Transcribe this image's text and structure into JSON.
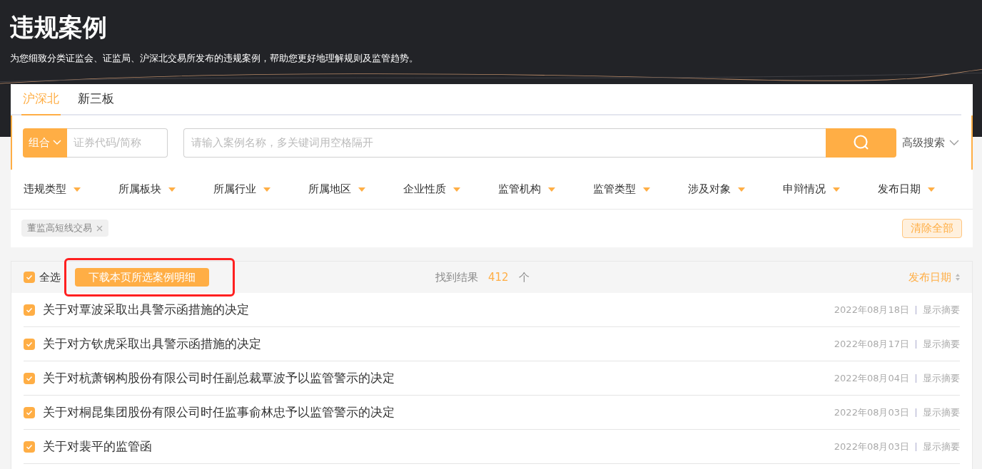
{
  "header": {
    "title": "违规案例",
    "subtitle": "为您细致分类证监会、证监局、沪深北交易所发布的违规案例，帮助您更好地理解规则及监管趋势。"
  },
  "tabs": [
    {
      "label": "沪深北",
      "selected": true
    },
    {
      "label": "新三板",
      "selected": false
    }
  ],
  "search": {
    "combo_label": "组合",
    "code_placeholder": "证券代码/简称",
    "keyword_placeholder": "请输入案例名称，多关键词用空格隔开",
    "advanced_label": "高级搜索"
  },
  "filters": [
    "违规类型",
    "所属板块",
    "所属行业",
    "所属地区",
    "企业性质",
    "监管机构",
    "监管类型",
    "涉及对象",
    "申辩情况",
    "发布日期"
  ],
  "selected_tags": [
    "董监高短线交易"
  ],
  "clear_all": "清除全部",
  "results": {
    "select_all": {
      "label": "全选",
      "checked": true
    },
    "download": {
      "label": "下载本页所选案例明细",
      "highlighted": true
    },
    "found_label": "找到结果",
    "count": "412",
    "unit": "个",
    "sort_label": "发布日期",
    "rows": [
      {
        "title": "关于对覃波采取出具警示函措施的决定",
        "date": "2022年08月18日",
        "action": "显示摘要",
        "checked": true
      },
      {
        "title": "关于对方钦虎采取出具警示函措施的决定",
        "date": "2022年08月17日",
        "action": "显示摘要",
        "checked": true
      },
      {
        "title": "关于对杭萧钢构股份有限公司时任副总裁覃波予以监管警示的决定",
        "date": "2022年08月04日",
        "action": "显示摘要",
        "checked": true
      },
      {
        "title": "关于对桐昆集团股份有限公司时任监事俞林忠予以监管警示的决定",
        "date": "2022年08月03日",
        "action": "显示摘要",
        "checked": true
      },
      {
        "title": "关于对裴平的监管函",
        "date": "2022年08月03日",
        "action": "显示摘要",
        "checked": true
      }
    ]
  }
}
